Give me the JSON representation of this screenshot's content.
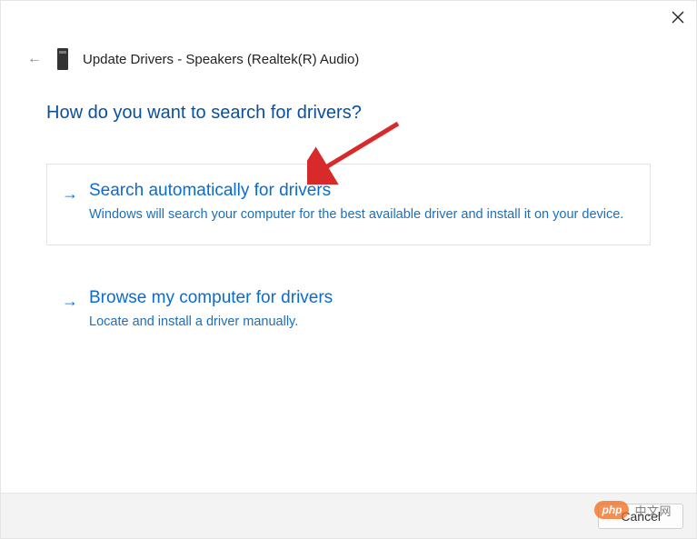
{
  "header": {
    "title": "Update Drivers - Speakers (Realtek(R) Audio)"
  },
  "question": "How do you want to search for drivers?",
  "options": [
    {
      "title": "Search automatically for drivers",
      "description": "Windows will search your computer for the best available driver and install it on your device."
    },
    {
      "title": "Browse my computer for drivers",
      "description": "Locate and install a driver manually."
    }
  ],
  "footer": {
    "cancel": "Cancel"
  },
  "watermark": {
    "badge": "php",
    "text": "中文网"
  }
}
